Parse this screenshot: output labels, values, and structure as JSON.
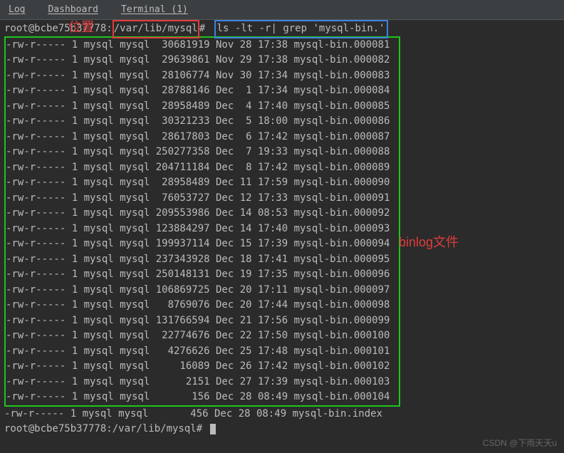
{
  "tabs": {
    "log": "Log",
    "dashboard": "Dashboard",
    "terminal": "Terminal (1)"
  },
  "prompt": {
    "prefix": "root@bcbe75b37778:",
    "path": "/var/lib/mysql",
    "hash": "#",
    "command": "ls -lt -r| grep 'mysql-bin.'"
  },
  "annotations": {
    "position": "位置",
    "binlog": "binlog文件"
  },
  "files": [
    {
      "perm": "-rw-r-----",
      "n": "1",
      "o": "mysql",
      "g": "mysql",
      "size": "30681919",
      "m": "Nov",
      "d": "28",
      "t": "17:38",
      "name": "mysql-bin.000081"
    },
    {
      "perm": "-rw-r-----",
      "n": "1",
      "o": "mysql",
      "g": "mysql",
      "size": "29639861",
      "m": "Nov",
      "d": "29",
      "t": "17:38",
      "name": "mysql-bin.000082"
    },
    {
      "perm": "-rw-r-----",
      "n": "1",
      "o": "mysql",
      "g": "mysql",
      "size": "28106774",
      "m": "Nov",
      "d": "30",
      "t": "17:34",
      "name": "mysql-bin.000083"
    },
    {
      "perm": "-rw-r-----",
      "n": "1",
      "o": "mysql",
      "g": "mysql",
      "size": "28788146",
      "m": "Dec",
      "d": " 1",
      "t": "17:34",
      "name": "mysql-bin.000084"
    },
    {
      "perm": "-rw-r-----",
      "n": "1",
      "o": "mysql",
      "g": "mysql",
      "size": "28958489",
      "m": "Dec",
      "d": " 4",
      "t": "17:40",
      "name": "mysql-bin.000085"
    },
    {
      "perm": "-rw-r-----",
      "n": "1",
      "o": "mysql",
      "g": "mysql",
      "size": "30321233",
      "m": "Dec",
      "d": " 5",
      "t": "18:00",
      "name": "mysql-bin.000086"
    },
    {
      "perm": "-rw-r-----",
      "n": "1",
      "o": "mysql",
      "g": "mysql",
      "size": "28617803",
      "m": "Dec",
      "d": " 6",
      "t": "17:42",
      "name": "mysql-bin.000087"
    },
    {
      "perm": "-rw-r-----",
      "n": "1",
      "o": "mysql",
      "g": "mysql",
      "size": "250277358",
      "m": "Dec",
      "d": " 7",
      "t": "19:33",
      "name": "mysql-bin.000088"
    },
    {
      "perm": "-rw-r-----",
      "n": "1",
      "o": "mysql",
      "g": "mysql",
      "size": "204711184",
      "m": "Dec",
      "d": " 8",
      "t": "17:42",
      "name": "mysql-bin.000089"
    },
    {
      "perm": "-rw-r-----",
      "n": "1",
      "o": "mysql",
      "g": "mysql",
      "size": "28958489",
      "m": "Dec",
      "d": "11",
      "t": "17:59",
      "name": "mysql-bin.000090"
    },
    {
      "perm": "-rw-r-----",
      "n": "1",
      "o": "mysql",
      "g": "mysql",
      "size": "76053727",
      "m": "Dec",
      "d": "12",
      "t": "17:33",
      "name": "mysql-bin.000091"
    },
    {
      "perm": "-rw-r-----",
      "n": "1",
      "o": "mysql",
      "g": "mysql",
      "size": "209553986",
      "m": "Dec",
      "d": "14",
      "t": "08:53",
      "name": "mysql-bin.000092"
    },
    {
      "perm": "-rw-r-----",
      "n": "1",
      "o": "mysql",
      "g": "mysql",
      "size": "123884297",
      "m": "Dec",
      "d": "14",
      "t": "17:40",
      "name": "mysql-bin.000093"
    },
    {
      "perm": "-rw-r-----",
      "n": "1",
      "o": "mysql",
      "g": "mysql",
      "size": "199937114",
      "m": "Dec",
      "d": "15",
      "t": "17:39",
      "name": "mysql-bin.000094"
    },
    {
      "perm": "-rw-r-----",
      "n": "1",
      "o": "mysql",
      "g": "mysql",
      "size": "237343928",
      "m": "Dec",
      "d": "18",
      "t": "17:41",
      "name": "mysql-bin.000095"
    },
    {
      "perm": "-rw-r-----",
      "n": "1",
      "o": "mysql",
      "g": "mysql",
      "size": "250148131",
      "m": "Dec",
      "d": "19",
      "t": "17:35",
      "name": "mysql-bin.000096"
    },
    {
      "perm": "-rw-r-----",
      "n": "1",
      "o": "mysql",
      "g": "mysql",
      "size": "106869725",
      "m": "Dec",
      "d": "20",
      "t": "17:11",
      "name": "mysql-bin.000097"
    },
    {
      "perm": "-rw-r-----",
      "n": "1",
      "o": "mysql",
      "g": "mysql",
      "size": "8769076",
      "m": "Dec",
      "d": "20",
      "t": "17:44",
      "name": "mysql-bin.000098"
    },
    {
      "perm": "-rw-r-----",
      "n": "1",
      "o": "mysql",
      "g": "mysql",
      "size": "131766594",
      "m": "Dec",
      "d": "21",
      "t": "17:56",
      "name": "mysql-bin.000099"
    },
    {
      "perm": "-rw-r-----",
      "n": "1",
      "o": "mysql",
      "g": "mysql",
      "size": "22774676",
      "m": "Dec",
      "d": "22",
      "t": "17:50",
      "name": "mysql-bin.000100"
    },
    {
      "perm": "-rw-r-----",
      "n": "1",
      "o": "mysql",
      "g": "mysql",
      "size": "4276626",
      "m": "Dec",
      "d": "25",
      "t": "17:48",
      "name": "mysql-bin.000101"
    },
    {
      "perm": "-rw-r-----",
      "n": "1",
      "o": "mysql",
      "g": "mysql",
      "size": "16089",
      "m": "Dec",
      "d": "26",
      "t": "17:42",
      "name": "mysql-bin.000102"
    },
    {
      "perm": "-rw-r-----",
      "n": "1",
      "o": "mysql",
      "g": "mysql",
      "size": "2151",
      "m": "Dec",
      "d": "27",
      "t": "17:39",
      "name": "mysql-bin.000103"
    },
    {
      "perm": "-rw-r-----",
      "n": "1",
      "o": "mysql",
      "g": "mysql",
      "size": "156",
      "m": "Dec",
      "d": "28",
      "t": "08:49",
      "name": "mysql-bin.000104"
    }
  ],
  "index_row": {
    "perm": "-rw-r-----",
    "n": "1",
    "o": "mysql",
    "g": "mysql",
    "size": "456",
    "m": "Dec",
    "d": "28",
    "t": "08:49",
    "name": "mysql-bin.index"
  },
  "prompt2": {
    "prefix": "root@bcbe75b37778:",
    "path": "/var/lib/mysql",
    "hash": "#"
  },
  "watermark": "CSDN @下雨天天u"
}
